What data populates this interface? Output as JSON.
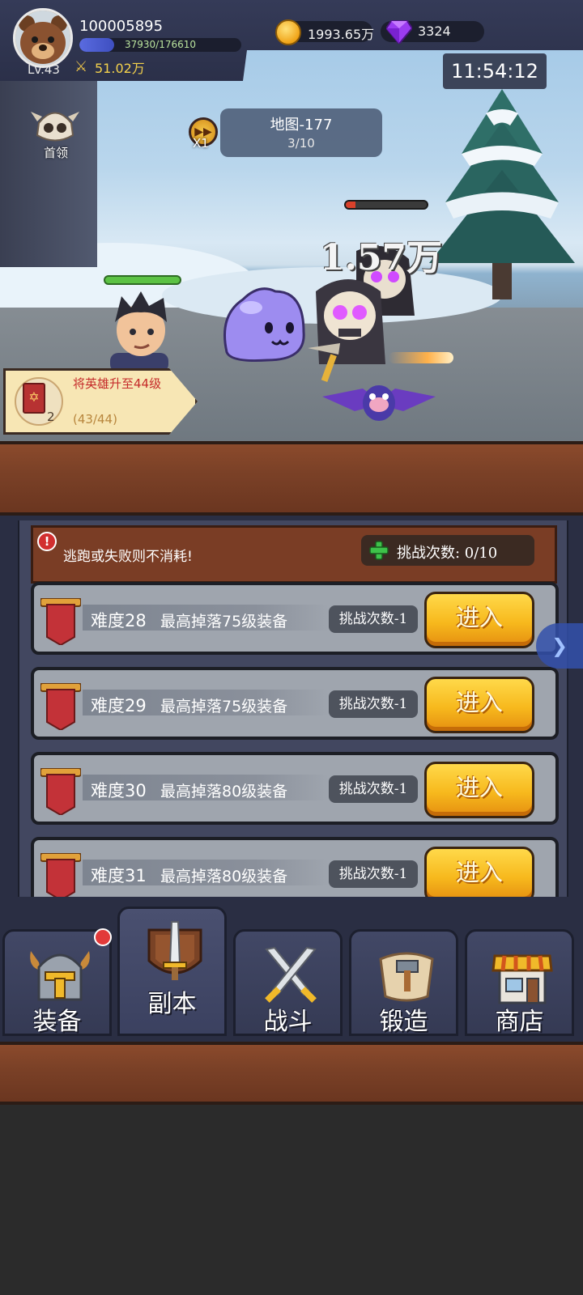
{
  "player": {
    "id": "100005895",
    "level": "Lv.43",
    "xp_text": "37930/176610",
    "xp_fraction": 0.215,
    "power": "51.02万"
  },
  "resources": {
    "gold": "1993.65万",
    "gems": "3324"
  },
  "clock": "11:54:12",
  "battle": {
    "boss_label": "首领",
    "speed_label": "X1",
    "map_name": "地图-177",
    "map_progress": "3/10",
    "damage": "1.57万",
    "enemy_hp_fraction": 0.12
  },
  "quest": {
    "title": "将英雄升至44级",
    "progress": "(43/44)",
    "count": "2"
  },
  "dungeon": {
    "notice": "逃跑或失败则不消耗!",
    "attempts": "挑战次数: 0/10",
    "rows": [
      {
        "difficulty": "难度28",
        "drop": "最高掉落75级装备",
        "cost": "挑战次数-1",
        "button": "进入"
      },
      {
        "difficulty": "难度29",
        "drop": "最高掉落75级装备",
        "cost": "挑战次数-1",
        "button": "进入"
      },
      {
        "difficulty": "难度30",
        "drop": "最高掉落80级装备",
        "cost": "挑战次数-1",
        "button": "进入"
      },
      {
        "difficulty": "难度31",
        "drop": "最高掉落80级装备",
        "cost": "挑战次数-1",
        "button": "进入"
      }
    ]
  },
  "nav": [
    {
      "label": "装备",
      "icon": "helmet-icon"
    },
    {
      "label": "副本",
      "icon": "sword-shield-icon"
    },
    {
      "label": "战斗",
      "icon": "crossed-swords-icon"
    },
    {
      "label": "锻造",
      "icon": "scroll-hammer-icon"
    },
    {
      "label": "商店",
      "icon": "shop-icon"
    }
  ],
  "colors": {
    "gold_button": "#f7b91d",
    "panel": "#424760",
    "wood": "#7b4127",
    "notification": "#e23a3a"
  }
}
